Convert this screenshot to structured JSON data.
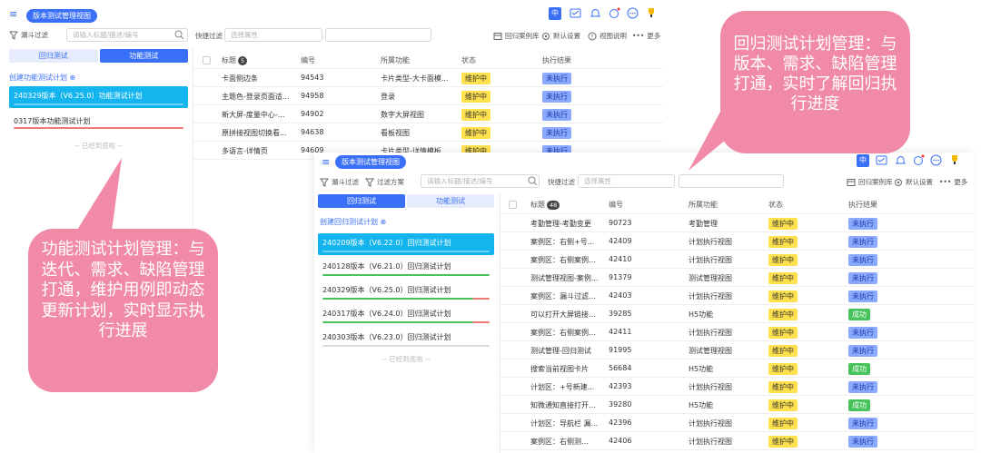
{
  "win1": {
    "title": "版本测试管理视图",
    "filter_funnel": "漏斗过滤",
    "search_placeholder": "请输入标题/描述/编号",
    "quick_filter": "快捷过滤",
    "attr_placeholder": "选择属性",
    "right_tools": {
      "lib": "回归案例库",
      "default": "默认设置",
      "view": "视图说明",
      "more": "更多"
    },
    "header_chip": "中",
    "tabs": [
      "回归测试",
      "功能测试"
    ],
    "create_link": "创建功能测试计划",
    "plans": [
      "240329版本（V6.25.0）功能测试计划",
      "0317版本功能测试计划"
    ],
    "no_more": "-- 已经到底啦 --",
    "columns": {
      "title": "标题",
      "count": "5",
      "id": "编号",
      "feature": "所属功能",
      "status": "状态",
      "result": "执行结果"
    },
    "rows": [
      {
        "title": "卡面侧边条",
        "id": "94543",
        "feature": "卡片类型-大卡面模...",
        "status": "维护中",
        "result": "未执行"
      },
      {
        "title": "主题色-登录页面适...",
        "id": "94958",
        "feature": "登录",
        "status": "维护中",
        "result": "未执行"
      },
      {
        "title": "新大屏-度量中心-...",
        "id": "94902",
        "feature": "数字大屏视图",
        "status": "维护中",
        "result": "未执行"
      },
      {
        "title": "原拼接视图切换看...",
        "id": "94638",
        "feature": "看板视图",
        "status": "维护中",
        "result": "未执行"
      },
      {
        "title": "多语言-详情页",
        "id": "94609",
        "feature": "卡片类型-详情模板",
        "status": "维护中",
        "result": "未执行"
      }
    ]
  },
  "win2": {
    "title": "版本测试管理视图",
    "filter_funnel": "漏斗过滤",
    "filter_plan": "过滤方案",
    "search_placeholder": "请输入标题/描述/编号",
    "quick_filter": "快捷过滤",
    "attr_placeholder": "选择属性",
    "right_tools": {
      "lib": "回归案例库",
      "default": "默认设置",
      "more": "更多"
    },
    "header_chip": "中",
    "tabs": [
      "回归测试",
      "功能测试"
    ],
    "create_link": "创建回归测试计划",
    "plans": [
      "240209版本（V6.22.0）回归测试计划",
      "240128版本（V6.21.0）回归测试计划",
      "240329版本（V6.25.0）回归测试计划",
      "240317版本（V6.24.0）回归测试计划",
      "240303版本（V6.23.0）回归测试计划"
    ],
    "no_more": "-- 已经到底啦 --",
    "columns": {
      "title": "标题",
      "count": "48",
      "id": "编号",
      "feature": "所属功能",
      "status": "状态",
      "result": "执行结果"
    },
    "rows": [
      {
        "title": "考勤管理-考勤变更",
        "id": "90723",
        "feature": "考勤管理",
        "status": "维护中",
        "result": "未执行"
      },
      {
        "title": "案例区：右侧+号...",
        "id": "42409",
        "feature": "计划执行视图",
        "status": "维护中",
        "result": "未执行"
      },
      {
        "title": "案例区：右侧案例...",
        "id": "42410",
        "feature": "计划执行视图",
        "status": "维护中",
        "result": "未执行"
      },
      {
        "title": "测试管理视图-案例...",
        "id": "91379",
        "feature": "测试管理视图",
        "status": "维护中",
        "result": "未执行"
      },
      {
        "title": "案例区：漏斗过滤...",
        "id": "42403",
        "feature": "计划执行视图",
        "status": "维护中",
        "result": "未执行"
      },
      {
        "title": "可以打开大屏链接...",
        "id": "39285",
        "feature": "H5功能",
        "status": "维护中",
        "result": "成功"
      },
      {
        "title": "案例区：右侧案例...",
        "id": "42411",
        "feature": "计划执行视图",
        "status": "维护中",
        "result": "未执行"
      },
      {
        "title": "测试管理-回归测试",
        "id": "91995",
        "feature": "测试管理视图",
        "status": "维护中",
        "result": "未执行"
      },
      {
        "title": "搜索当前视图卡片",
        "id": "56684",
        "feature": "H5功能",
        "status": "维护中",
        "result": "成功"
      },
      {
        "title": "计划区：+号新建...",
        "id": "42393",
        "feature": "计划执行视图",
        "status": "维护中",
        "result": "未执行"
      },
      {
        "title": "知微通知直接打开...",
        "id": "39280",
        "feature": "H5功能",
        "status": "维护中",
        "result": "成功"
      },
      {
        "title": "计划区：导航栏 漏...",
        "id": "42396",
        "feature": "计划执行视图",
        "status": "维护中",
        "result": "未执行"
      },
      {
        "title": "案例区：右侧测...",
        "id": "42406",
        "feature": "计划执行视图",
        "status": "维护中",
        "result": "未执行"
      }
    ]
  },
  "callouts": {
    "right": "回归测试计划管理：与版本、需求、缺陷管理打通，实时了解回归执行进度",
    "left": "功能测试计划管理：与迭代、需求、缺陷管理打通，维护用例即动态更新计划，实时显示执行进展"
  },
  "colors": {
    "accent": "#3a6ff7",
    "selected_plan": "#14b4ef",
    "callout": "#f18aa6",
    "tag_maint": "#ffe14d",
    "tag_pending": "#8aa9ff",
    "tag_success": "#47c35b"
  }
}
